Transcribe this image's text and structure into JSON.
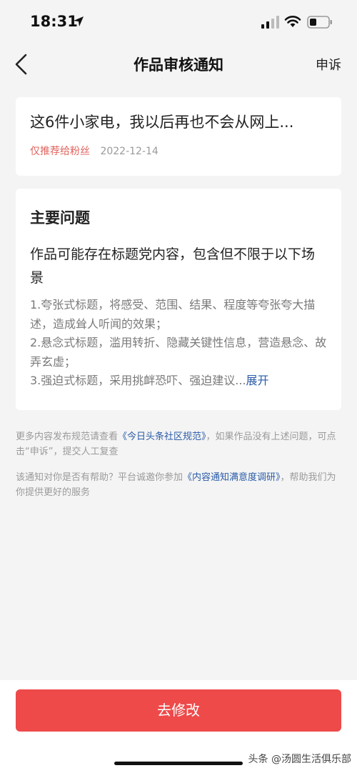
{
  "status_bar": {
    "time": "18:31"
  },
  "nav": {
    "title": "作品审核通知",
    "appeal_label": "申诉"
  },
  "article": {
    "title": "这6件小家电，我以后再也不会从网上...",
    "tag": "仅推荐给粉丝",
    "date": "2022-12-14"
  },
  "issue": {
    "heading": "主要问题",
    "summary": "作品可能存在标题党内容，包含但不限于以下场景",
    "details": "1.夸张式标题，将感受、范围、结果、程度等夸张夸大描述，造成耸人听闻的效果；\n2.悬念式标题，滥用转折、隐藏关键性信息，营造悬念、故弄玄虚；\n3.强迫式标题，采用挑衅恐吓、强迫建议...",
    "expand_label": "展开"
  },
  "notes": {
    "note1_prefix": "更多内容发布规范请查看",
    "note1_link": "《今日头条社区规范》",
    "note1_suffix": "，如果作品没有上述问题，可点击“申诉”，提交人工复查",
    "note2_prefix": "该通知对你是否有帮助？平台诚邀你参加",
    "note2_link": "《内容通知满意度调研》",
    "note2_suffix": "，帮助我们为你提供更好的服务"
  },
  "actions": {
    "primary_label": "去修改"
  },
  "watermark": "头条 @汤圆生活俱乐部",
  "colors": {
    "accent": "#ee4a4a",
    "link": "#2a5ca8",
    "tag": "#e0645f"
  },
  "icons": [
    "location-arrow-icon",
    "cellular-signal-icon",
    "wifi-icon",
    "battery-icon",
    "back-chevron-icon"
  ]
}
